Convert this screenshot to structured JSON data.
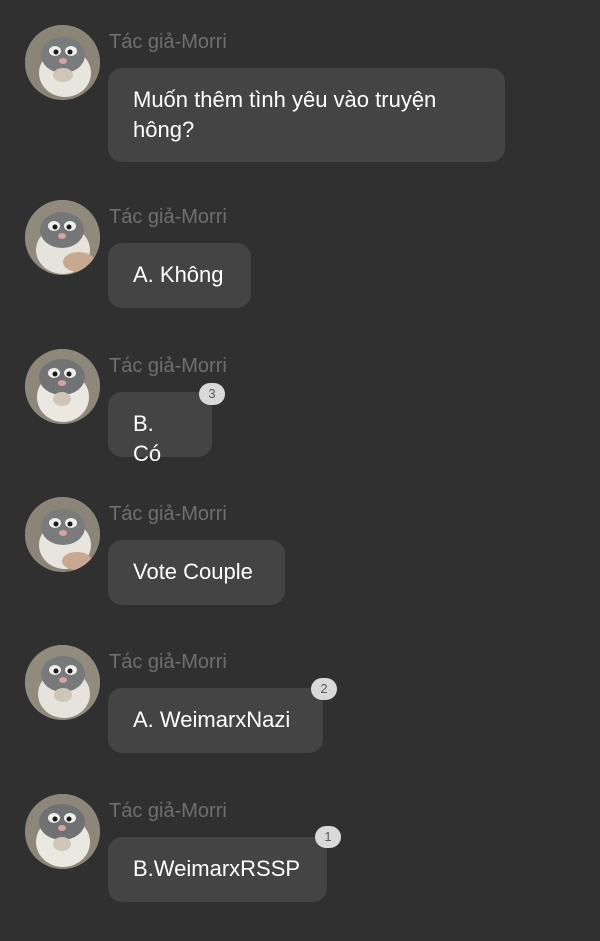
{
  "messages": [
    {
      "author": "Tác giả-Morri",
      "text": "Muốn thêm tình yêu vào truyện\nhông?",
      "badge": ""
    },
    {
      "author": "Tác giả-Morri",
      "text": "A. Không",
      "badge": ""
    },
    {
      "author": "Tác giả-Morri",
      "text": "B. Có",
      "badge": "3"
    },
    {
      "author": "Tác giả-Morri",
      "text": "Vote Couple",
      "badge": ""
    },
    {
      "author": "Tác giả-Morri",
      "text": "A. WeimarxNazi",
      "badge": "2"
    },
    {
      "author": "Tác giả-Morri",
      "text": "B.WeimarxRSSP",
      "badge": "1"
    }
  ],
  "colors": {
    "background": "#303030",
    "bubble": "#444444",
    "author": "#6f6f6f",
    "text": "#ffffff",
    "badge": "#d9d9d9"
  },
  "icons": {
    "avatar": "hamster-avatar-icon",
    "badge": "reaction-count-badge"
  }
}
